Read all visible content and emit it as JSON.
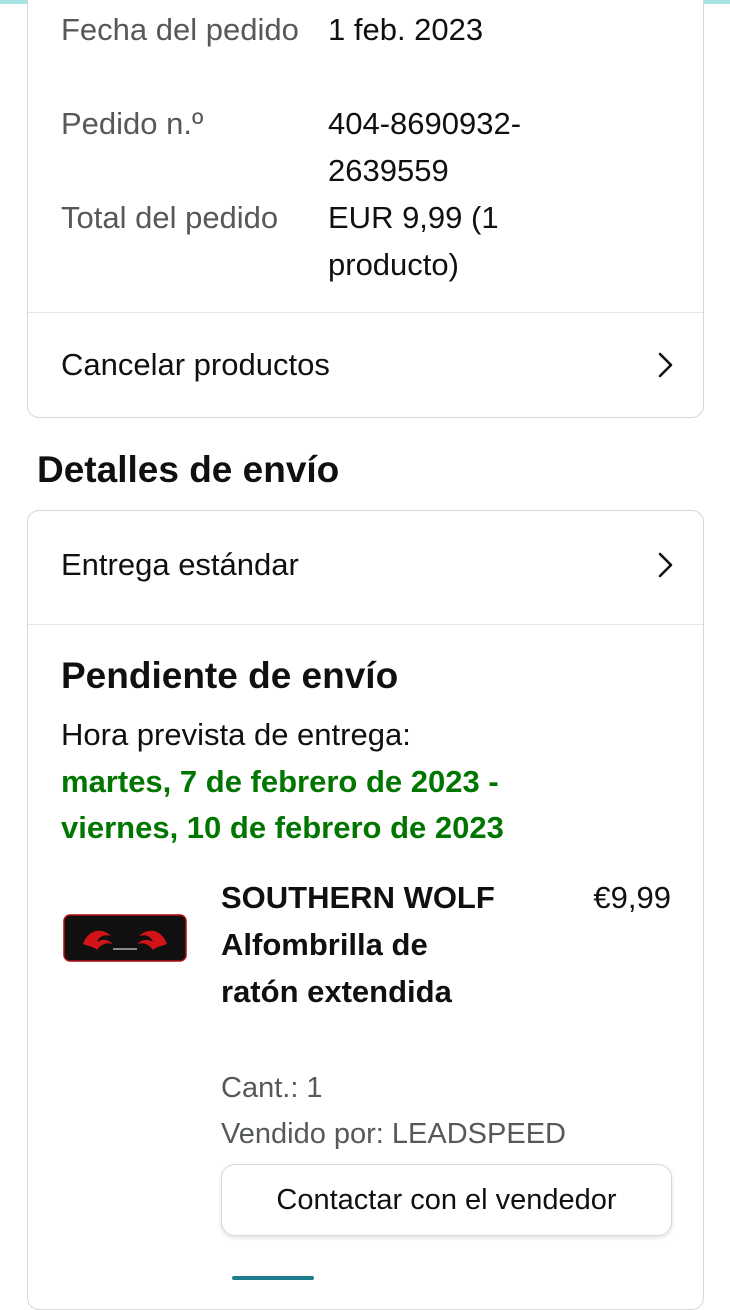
{
  "order_summary": {
    "date_label": "Fecha del pedido",
    "date_value": "1 feb. 2023",
    "number_label": "Pedido n.º",
    "number_value": "404-8690932-2639559",
    "total_label": "Total del pedido",
    "total_value": "EUR 9,99 (1 producto)",
    "cancel_label": "Cancelar productos"
  },
  "shipping": {
    "section_title": "Detalles de envío",
    "delivery_option": "Entrega estándar",
    "status": "Pendiente de envío",
    "eta_label": "Hora prevista de entrega:",
    "eta_line1": "martes, 7 de febrero de 2023 -",
    "eta_line2": "viernes, 10 de febrero de 2023"
  },
  "product": {
    "name": "SOUTHERN WOLF Alfombrilla de ratón extendida",
    "price": "€9,99",
    "quantity": "Cant.: 1",
    "seller": "Vendido por: LEADSPEED",
    "contact_button": "Contactar con el vendedor"
  },
  "colors": {
    "green": "#007600",
    "text": "#0f1111",
    "muted": "#565959",
    "border": "#d5d9d9"
  },
  "icons": {
    "chevron": "chevron-right-icon"
  }
}
